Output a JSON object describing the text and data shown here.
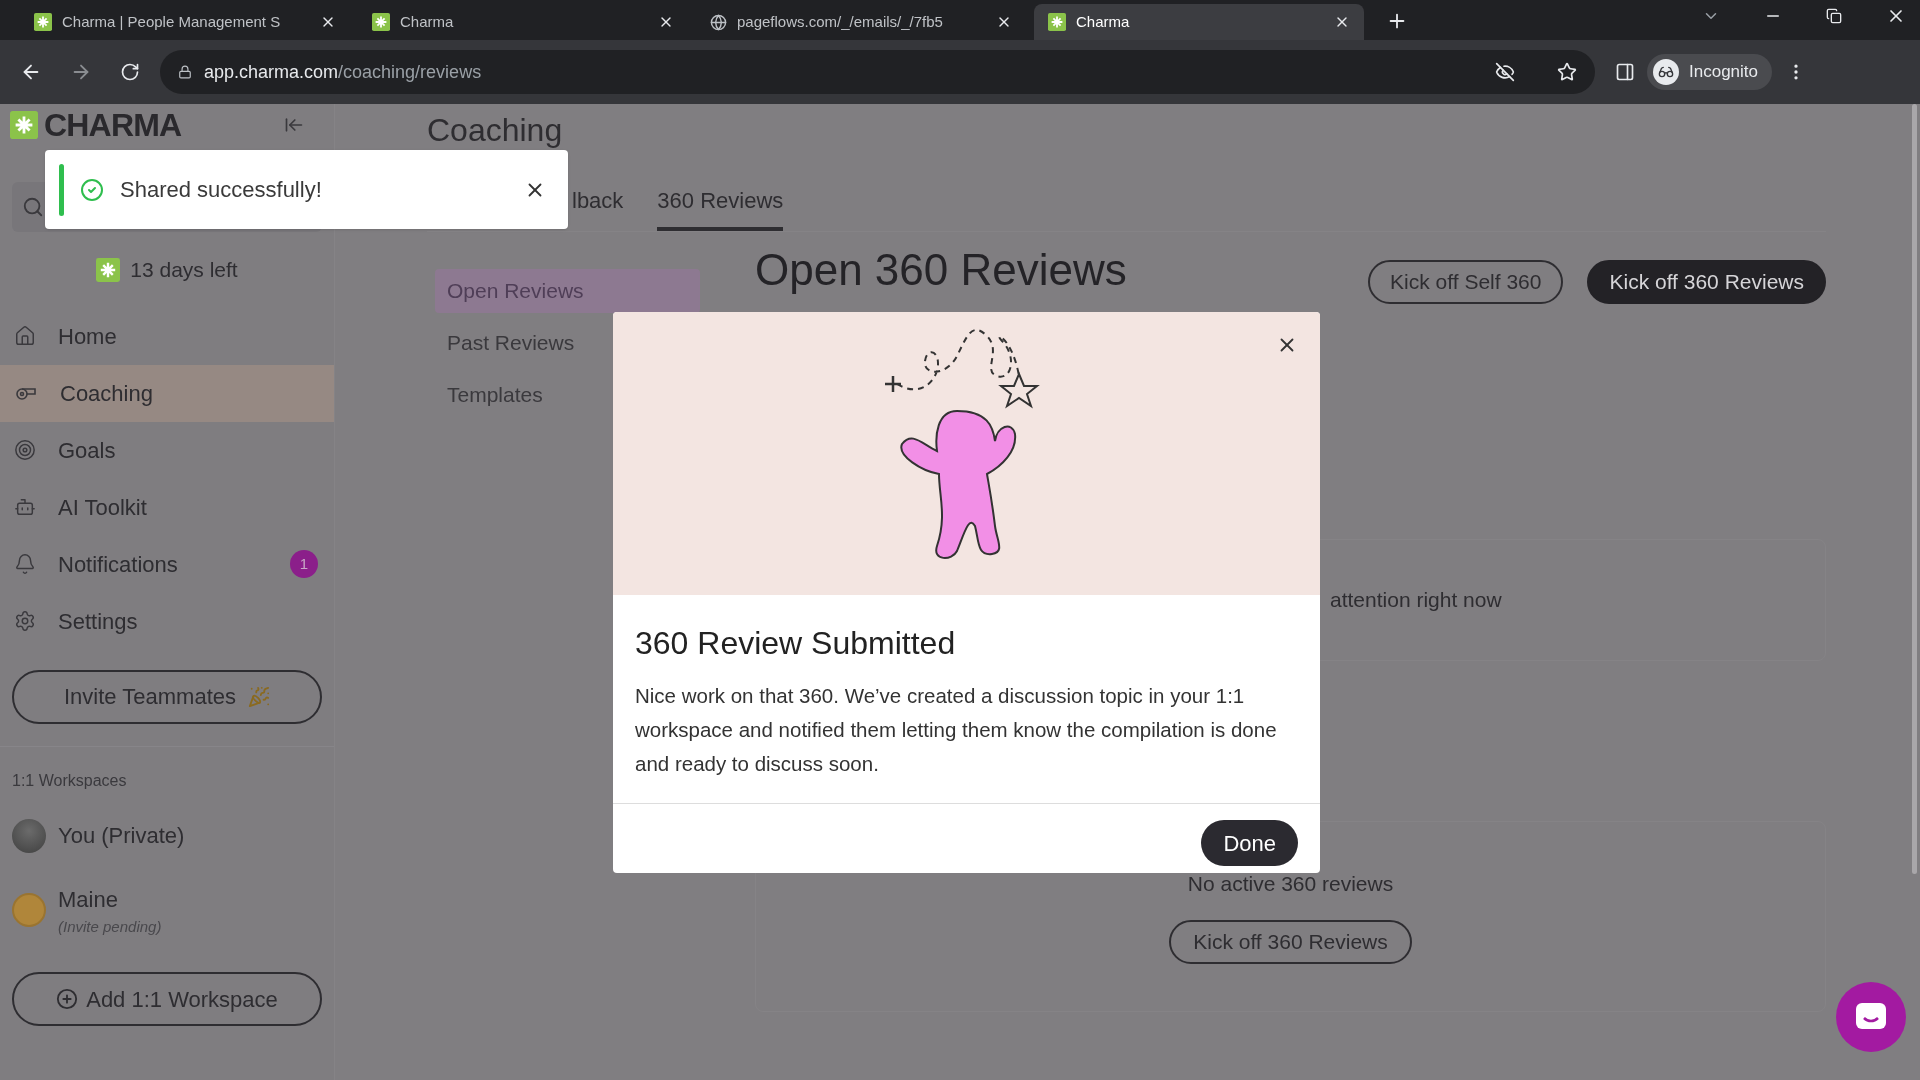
{
  "browser": {
    "tabs": [
      {
        "title": "Charma | People Management S",
        "selected": false
      },
      {
        "title": "Charma",
        "selected": false
      },
      {
        "title": "pageflows.com/_/emails/_/7fb5",
        "selected": false
      },
      {
        "title": "Charma",
        "selected": true
      }
    ],
    "address": {
      "host": "app.charma.com",
      "path": "/coaching/reviews"
    },
    "profile": "Incognito"
  },
  "toast": {
    "message": "Shared successfully!"
  },
  "sidebar": {
    "logo": "CHARMA",
    "trial": "13 days left",
    "items": [
      {
        "label": "Home",
        "selected": false
      },
      {
        "label": "Coaching",
        "selected": true
      },
      {
        "label": "Goals",
        "selected": false
      },
      {
        "label": "AI Toolkit",
        "selected": false
      },
      {
        "label": "Notifications",
        "selected": false,
        "badge": "1"
      },
      {
        "label": "Settings",
        "selected": false
      }
    ],
    "invite_button": "Invite Teammates",
    "section_title": "1:1 Workspaces",
    "workspaces": [
      {
        "name": "You (Private)"
      },
      {
        "name": "Maine",
        "note": "(Invite pending)"
      }
    ],
    "add_button": "Add 1:1 Workspace"
  },
  "page": {
    "title": "Coaching",
    "tabs": [
      {
        "label": "lback",
        "selected": false
      },
      {
        "label": "360 Reviews",
        "selected": true
      }
    ],
    "subnav": [
      {
        "label": "Open Reviews",
        "selected": true
      },
      {
        "label": "Past Reviews",
        "selected": false
      },
      {
        "label": "Templates",
        "selected": false
      }
    ],
    "heading": "Open 360 Reviews",
    "buttons": [
      {
        "label": "Kick off Self 360",
        "kind": "outline"
      },
      {
        "label": "Kick off 360 Reviews",
        "kind": "filled"
      }
    ],
    "attention_card": {
      "text": "attention right now"
    },
    "empty_card": {
      "text": "No active 360 reviews",
      "button": "Kick off 360 Reviews"
    }
  },
  "modal": {
    "title": "360 Review Submitted",
    "body": "Nice work on that 360. We’ve created a discussion topic in your 1:1 workspace and notified them letting them know the compilation is done and ready to discuss soon.",
    "button": "Done"
  }
}
